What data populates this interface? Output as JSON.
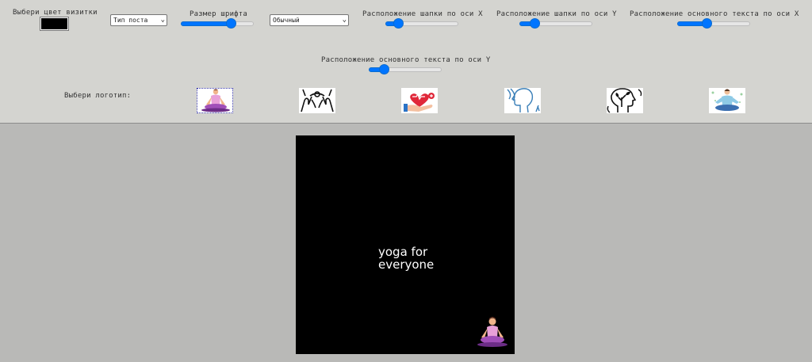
{
  "controls": {
    "color_label": "Выбери цвет визитки",
    "color_value": "#000000",
    "post_type": {
      "selected": "Тип поста"
    },
    "font_size": {
      "label": "Размер шрифта",
      "value_pct": 70
    },
    "font_weight": {
      "selected": "Обычный"
    },
    "header_x": {
      "label": "Расположение шапки по оси X",
      "value_pct": 12
    },
    "header_y": {
      "label": "Расположение шапки по оси Y",
      "value_pct": 16
    },
    "body_x": {
      "label": "Расположение основного текста по оси X",
      "value_pct": 38
    },
    "body_y": {
      "label": "Расположение основного текста по оси Y",
      "value_pct": 16
    },
    "logo_label": "Выбери логотип:",
    "logos": [
      {
        "icon": "yoga-pose-icon",
        "selected": true
      },
      {
        "icon": "hands-icon",
        "selected": false
      },
      {
        "icon": "heart-care-icon",
        "selected": false
      },
      {
        "icon": "head-profile-icon",
        "selected": false
      },
      {
        "icon": "mind-tree-icon",
        "selected": false
      },
      {
        "icon": "meditation-icon",
        "selected": false
      }
    ]
  },
  "card": {
    "background": "#000000",
    "text_line1": "yoga for",
    "text_line2": "everyone",
    "text_color": "#ffffff",
    "logo_icon": "yoga-pose-icon"
  }
}
